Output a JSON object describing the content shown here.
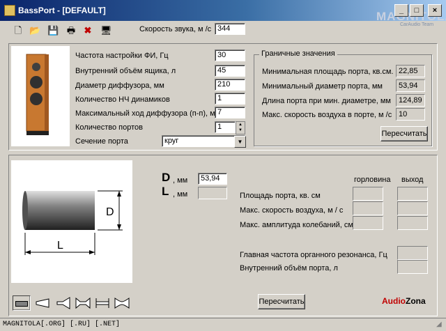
{
  "app": {
    "title": "BassPort - [DEFAULT]",
    "watermark": "MAGNITOLA",
    "watermark_sub": "CarAudio Team"
  },
  "toolbar": {
    "sound_speed_label": "Скорость звука, м /с",
    "sound_speed_value": "344",
    "icons": [
      "new-icon",
      "open-icon",
      "save-icon",
      "print-icon",
      "delete-icon",
      "display-icon"
    ]
  },
  "params": {
    "tuning_freq_label": "Частота настройки ФИ, Гц",
    "tuning_freq_value": "30",
    "box_volume_label": "Внутренний объём ящика, л",
    "box_volume_value": "45",
    "cone_diameter_label": "Диаметр диффузора, мм",
    "cone_diameter_value": "210",
    "woofer_count_label": "Количество НЧ динамиков",
    "woofer_count_value": "1",
    "max_excursion_label": "Максимальный ход диффузора (п-п), мм",
    "max_excursion_value": "7",
    "port_count_label": "Количество портов",
    "port_count_value": "1",
    "port_section_label": "Сечение порта",
    "port_section_value": "круг"
  },
  "limits": {
    "group_title": "Граничные значения",
    "min_area_label": "Минимальная площадь порта, кв.см.",
    "min_area_value": "22,85",
    "min_diameter_label": "Минимальный диаметр порта, мм",
    "min_diameter_value": "53,94",
    "port_length_label": "Длина порта при мин. диаметре, мм",
    "port_length_value": "124,89",
    "max_air_speed_label": "Макс. скорость воздуха в порте, м /с",
    "max_air_speed_value": "10",
    "recalc_label": "Пересчитать"
  },
  "port": {
    "d_letter": "D",
    "d_unit": ", мм",
    "d_value": "53,94",
    "l_letter": "L",
    "l_unit": ", мм",
    "l_value": "",
    "throat_header": "горловина",
    "exit_header": "выход",
    "area_label": "Площадь порта, кв. см",
    "air_speed_label": "Макс. скорость воздуха, м / с",
    "amplitude_label": "Макс. амплитуда колебаний, см",
    "organ_freq_label": "Главная частота органного резонанса, Гц",
    "port_volume_label": "Внутренний объём порта, л",
    "diagram_d": "D",
    "diagram_l": "L",
    "recalc_label": "Пересчитать",
    "brand_audio": "Audio",
    "brand_zona": "Zona"
  },
  "status": {
    "text": "MAGNITOLA[.ORG] [.RU] [.NET]"
  }
}
